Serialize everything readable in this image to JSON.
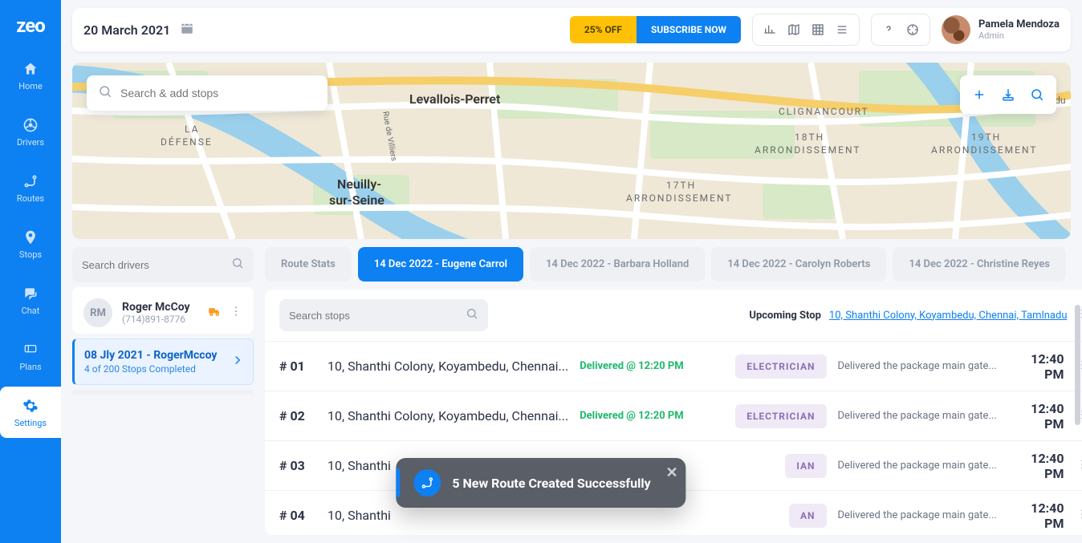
{
  "brand": {
    "name": "zeo"
  },
  "sidebar": {
    "items": [
      {
        "label": "Home",
        "icon": "home"
      },
      {
        "label": "Drivers",
        "icon": "steering"
      },
      {
        "label": "Routes",
        "icon": "route"
      },
      {
        "label": "Stops",
        "icon": "pin"
      },
      {
        "label": "Chat",
        "icon": "chat"
      },
      {
        "label": "Plans",
        "icon": "ticket"
      },
      {
        "label": "Settings",
        "icon": "gear"
      }
    ],
    "active": "Settings"
  },
  "topbar": {
    "date": "20 March 2021",
    "promo": {
      "off_label": "25% OFF",
      "subscribe_label": "SUBSCRIBE NOW"
    },
    "user": {
      "name": "Pamela Mendoza",
      "role": "Admin"
    }
  },
  "map": {
    "search_placeholder": "Search & add stops",
    "labels": {
      "levallois": "Levallois-Perret",
      "ladefense_line1": "LA",
      "ladefense_line2": "DÉFENSE",
      "neuilly_line1": "Neuilly-",
      "neuilly_line2": "sur-Seine",
      "arr17_line1": "17TH",
      "arr17_line2": "ARRONDISSEMENT",
      "arr18_line1": "18TH",
      "arr18_line2": "ARRONDISSEMENT",
      "arr19_line1": "19TH",
      "arr19_line2": "ARRONDISSEMENT",
      "clignancourt": "CLIGNANCOURT",
      "vienne": "et de l'Indu",
      "rue_villiers": "Rue de Villiers"
    }
  },
  "driver_panel": {
    "search_placeholder": "Search drivers",
    "selected": {
      "initials": "RM",
      "name": "Roger McCoy",
      "phone": "(714)891-8776"
    },
    "route": {
      "title": "08 Jly 2021 - RogerMccoy",
      "sub": "4 of 200 Stops Completed"
    }
  },
  "tabs": [
    {
      "label": "Route Stats",
      "active": false
    },
    {
      "label": "14 Dec 2022 - Eugene Carrol",
      "active": true
    },
    {
      "label": "14 Dec 2022 - Barbara Holland",
      "active": false
    },
    {
      "label": "14 Dec 2022 - Carolyn Roberts",
      "active": false
    },
    {
      "label": "14 Dec 2022 - Christine Reyes",
      "active": false
    }
  ],
  "stops_panel": {
    "search_placeholder": "Search stops",
    "upcoming_label": "Upcoming Stop",
    "upcoming_link": "10, Shanthi Colony, Koyambedu, Chennai, Tamlnadu",
    "rows": [
      {
        "id": "# 01",
        "addr": "10, Shanthi Colony, Koyambedu, Chennai...",
        "status": "Delivered @ 12:20 PM",
        "tag": "ELECTRICIAN",
        "note": "Delivered the package main gate...",
        "time": "12:40 PM"
      },
      {
        "id": "# 02",
        "addr": "10, Shanthi Colony, Koyambedu, Chennai...",
        "status": "Delivered @ 12:20 PM",
        "tag": "ELECTRICIAN",
        "note": "Delivered the package main gate...",
        "time": "12:40 PM"
      },
      {
        "id": "# 03",
        "addr": "10, Shanthi",
        "status": "",
        "tag": "IAN",
        "note": "Delivered the package main gate...",
        "time": "12:40 PM"
      },
      {
        "id": "# 04",
        "addr": "10, Shanthi",
        "status": "",
        "tag": "AN",
        "note": "Delivered the package main gate...",
        "time": "12:40 PM"
      }
    ]
  },
  "toast": {
    "message": "5 New Route Created Successfully"
  },
  "colors": {
    "primary": "#0d80f2",
    "accent": "#ffc107",
    "success": "#1db96b",
    "tag_bg": "#efeaf6",
    "tag_fg": "#8a6fb5"
  }
}
